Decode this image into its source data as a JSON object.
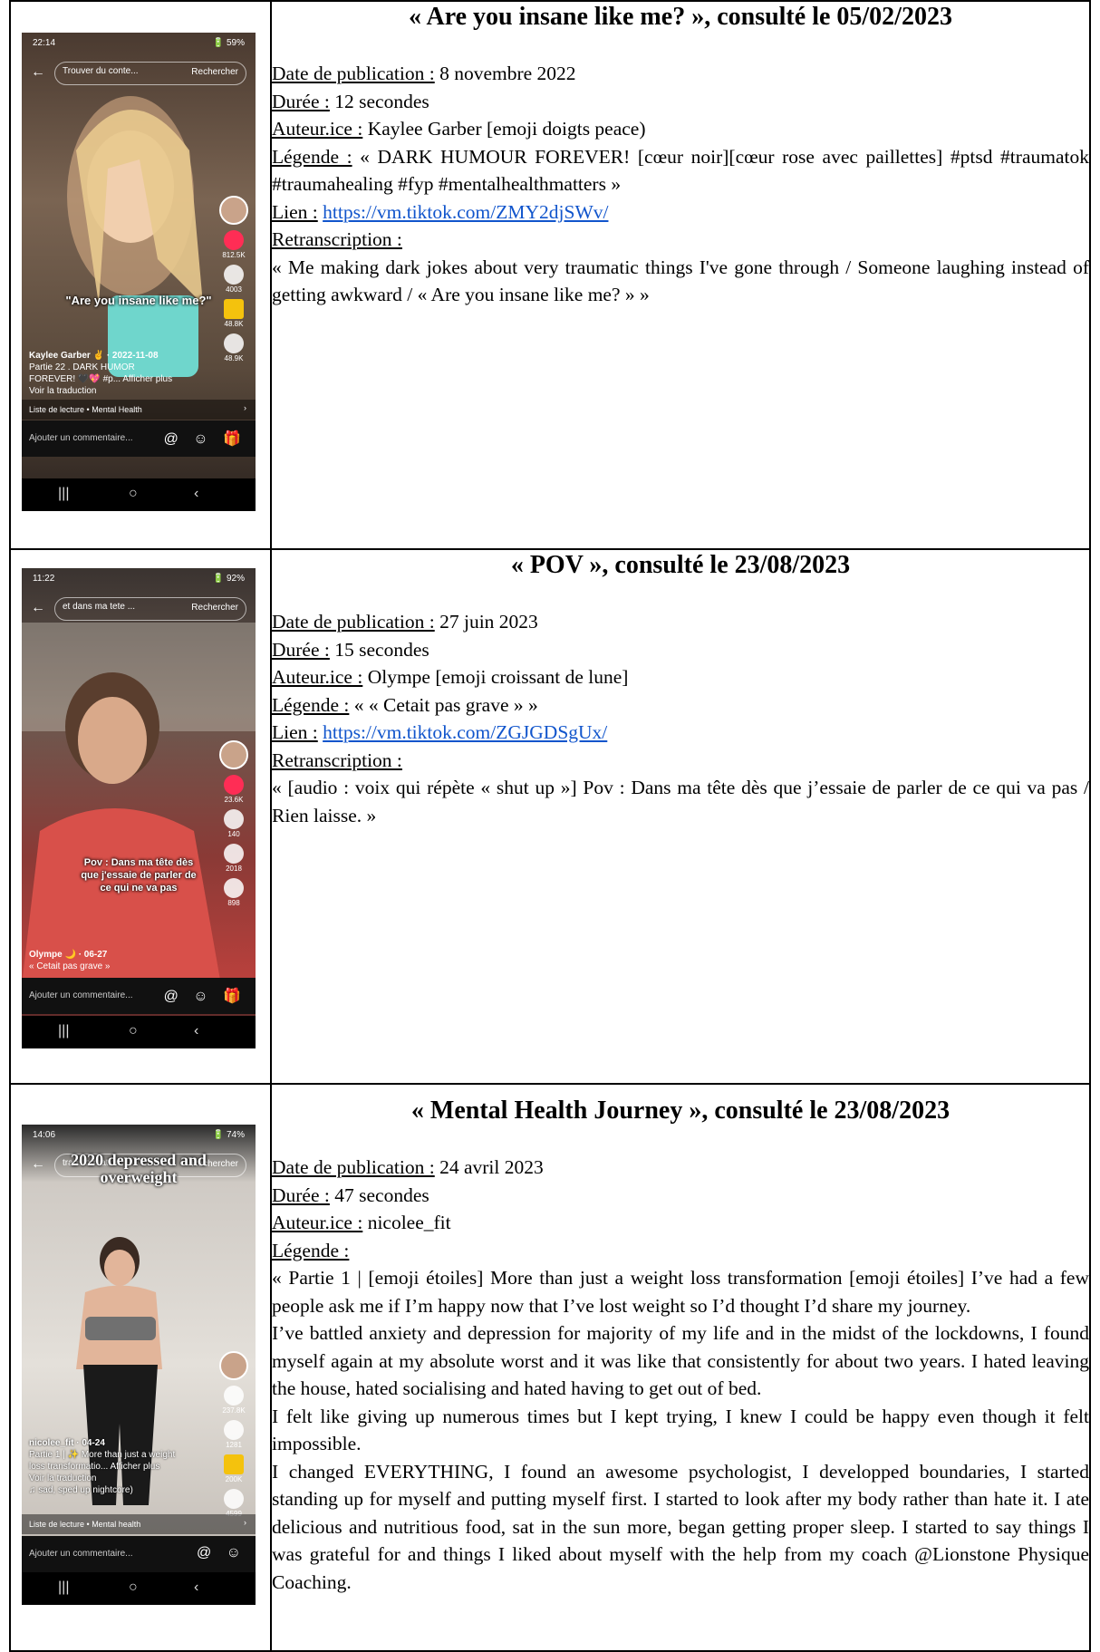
{
  "entries": [
    {
      "title": "« Are you insane like me? », consulté le 05/02/2023",
      "date_label": "Date de publication :",
      "date_value": " 8 novembre 2022",
      "duration_label": "Durée :",
      "duration_value": " 12 secondes",
      "author_label": "Auteur.ice :",
      "author_value": " Kaylee Garber [emoji doigts peace)",
      "caption_label": "Légende :",
      "caption_value": " « DARK HUMOUR FOREVER! [cœur noir][cœur rose avec paillettes] #ptsd #traumatok #traumahealing #fyp #mentalhealthmatters »",
      "link_label": "Lien :",
      "link_url": "https://vm.tiktok.com/ZMY2djSWv/",
      "transcript_label": "Retranscription :",
      "transcript_text": "« Me making dark jokes about very traumatic things I've gone through / Someone laughing instead of getting awkward / « Are you insane like me? » »",
      "phone": {
        "time": "22:14",
        "status": "🔋 59%",
        "search_placeholder": "Trouver du conte...",
        "search_button": "Rechercher",
        "overlay": "\"Are you insane like me?\"",
        "counts": [
          "812.5K",
          "4003",
          "48.8K",
          "48.9K"
        ],
        "author_line": "Kaylee Garber ✌ · 2022-11-08",
        "caption_line1": "Partie 22 . DARK HUMOR",
        "caption_line2": "FOREVER! 🖤💖 #p... Afficher plus",
        "translate": "Voir la traduction",
        "playlist": "Liste de lecture • Mental Health",
        "comment_placeholder": "Ajouter un commentaire...",
        "comment_icons": "@ ☺ 🎁"
      }
    },
    {
      "title": "« POV », consulté le 23/08/2023",
      "date_label": "Date de publication :",
      "date_value": " 27 juin 2023",
      "duration_label": "Durée :",
      "duration_value": " 15 secondes",
      "author_label": "Auteur.ice :",
      "author_value": " Olympe [emoji croissant de lune]",
      "caption_label": "Légende :",
      "caption_value": " « « Cetait pas grave » »",
      "link_label": "Lien :",
      "link_url": "https://vm.tiktok.com/ZGJGDSgUx/",
      "transcript_label": "Retranscription :",
      "transcript_text": "« [audio : voix qui répète « shut up »] Pov : Dans ma tête dès que j’essaie de parler de ce qui va pas / Rien laisse. »",
      "phone": {
        "time": "11:22",
        "status": "🔋 92%",
        "search_placeholder": "et dans ma tete ...",
        "search_button": "Rechercher",
        "overlay": "Pov : Dans ma tête dès que j'essaie de parler de ce qui ne va pas",
        "counts": [
          "23.6K",
          "140",
          "2018",
          "898"
        ],
        "author_line": "Olympe 🌙 · 06-27",
        "caption_line1": "« Cetait pas grave »",
        "comment_placeholder": "Ajouter un commentaire...",
        "comment_icons": "@ ☺ 🎁"
      }
    },
    {
      "title": "« Mental Health Journey », consulté le 23/08/2023",
      "date_label": "Date de publication :",
      "date_value": " 24 avril 2023",
      "duration_label": "Durée :",
      "duration_value": " 47 secondes",
      "author_label": "Auteur.ice :",
      "author_value": " nicolee_fit",
      "caption_label": "Légende :",
      "paragraphs": [
        "« Partie 1 | [emoji étoiles] More than just a weight loss transformation [emoji étoiles] I’ve had a few people ask me if I’m happy now that I’ve lost weight so I’d thought I’d share my journey.",
        "I’ve battled anxiety and depression for majority of my life and in the midst of the lockdowns, I found myself again at my absolute worst and it was like that consistently for about two years. I hated leaving the house, hated socialising and hated having to get out of bed.",
        "I felt like giving up numerous times but I kept trying, I knew I could be happy even though it felt impossible.",
        "I changed EVERYTHING, I found an awesome psychologist, I developped boundaries, I started standing up for myself and putting myself first. I started to look after my body rather than hate it. I ate delicious and nutritious food, sat in the sun more, began getting proper sleep. I started to say things I was grateful for and things I liked about myself with the help from my coach @Lionstone Physique Coaching."
      ],
      "phone": {
        "time": "14:06",
        "status": "🔋 74%",
        "search_placeholder": "transformation",
        "search_button": "Rechercher",
        "overlay": "2020 depressed and overweight",
        "counts": [
          "237.8K",
          "1281",
          "200K",
          "4599"
        ],
        "author_line": "nicolee_fit · 04-24",
        "caption_line1": "Partie 1 | ✨ More than just a weight",
        "caption_line2": "loss transformatio... Afficher plus",
        "translate": "Voir la traduction",
        "sound": "♫ sad, sped up nightcore)",
        "playlist": "Liste de lecture • Mental health",
        "comment_placeholder": "Ajouter un commentaire...",
        "comment_icons": "@ ☺"
      }
    }
  ]
}
